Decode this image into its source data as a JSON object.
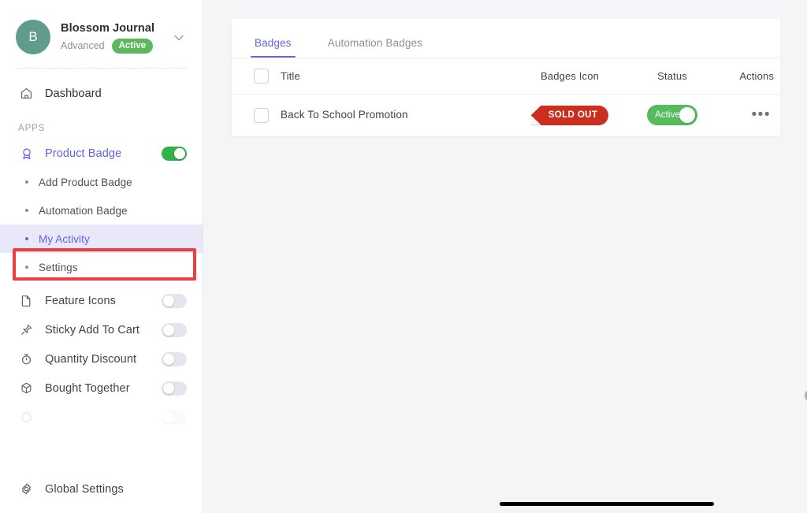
{
  "sidebar": {
    "store": {
      "avatar_letter": "B",
      "name": "Blossom Journal",
      "plan": "Advanced",
      "status_badge": "Active",
      "caret_icon": "chevron-down-icon"
    },
    "dashboard": {
      "label": "Dashboard",
      "icon": "home-icon"
    },
    "section_label": "APPS",
    "apps": [
      {
        "label": "Product Badge",
        "icon": "award-badge-icon",
        "toggle": "on",
        "active": true
      },
      {
        "label": "Feature Icons",
        "icon": "document-icon",
        "toggle": "off",
        "active": false
      },
      {
        "label": "Sticky Add To Cart",
        "icon": "pin-icon",
        "toggle": "off",
        "active": false
      },
      {
        "label": "Quantity Discount",
        "icon": "stopwatch-icon",
        "toggle": "off",
        "active": false
      },
      {
        "label": "Bought Together",
        "icon": "package-box-icon",
        "toggle": "off",
        "active": false
      }
    ],
    "sub_items": [
      {
        "label": "Add Product Badge",
        "selected": false
      },
      {
        "label": "Automation Badge",
        "selected": false
      },
      {
        "label": "My Activity",
        "selected": true
      },
      {
        "label": "Settings",
        "selected": false
      }
    ],
    "global_settings": {
      "label": "Global Settings",
      "icon": "gear-icon"
    }
  },
  "highlight": {
    "color": "#ef3e42",
    "target": "My Activity"
  },
  "main": {
    "tabs": [
      {
        "label": "Badges",
        "selected": true
      },
      {
        "label": "Automation Badges",
        "selected": false
      }
    ],
    "table": {
      "columns": [
        "Title",
        "Badges Icon",
        "Status",
        "Actions"
      ],
      "select_all_checkbox": "unchecked",
      "rows": [
        {
          "checkbox": "unchecked",
          "title": "Back To School Promotion",
          "badge_text": "SOLD OUT",
          "badge_color": "#cb2e1e",
          "status_label": "Active",
          "status_state": "on",
          "status_color": "#55bb5d",
          "actions_icon": "ellipsis-icon"
        }
      ]
    },
    "fab_icon": "user-avatar-icon",
    "cursor_icon": "pointer-dot"
  },
  "colors": {
    "accent": "#6361e8",
    "toggle_on": "#35b14a",
    "highlight": "#ef3e42",
    "canvas": "#f4f5f7"
  }
}
